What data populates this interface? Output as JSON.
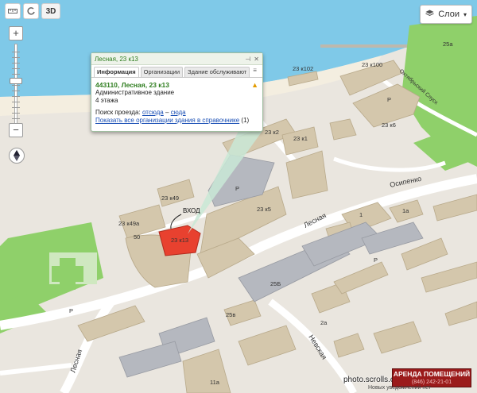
{
  "toolbar": {
    "ruler_icon": "ruler-icon",
    "rotate_icon": "rotate-icon",
    "mode_3d": "3D"
  },
  "layers": {
    "label": "Слои",
    "icon": "layers-icon"
  },
  "zoom": {
    "plus": "+",
    "minus": "−",
    "level_fraction": 0.55
  },
  "balloon": {
    "header": "Лесная, 23 к13",
    "tabs": [
      "Информация",
      "Организации",
      "Здание обслуживают"
    ],
    "active_tab": 0,
    "address": "443110, Лесная, 23 к13",
    "type": "Административное здание",
    "floors": "4 этажа",
    "route_label": "Поиск проезда:",
    "route_from": "отсюда",
    "route_dash": "–",
    "route_to": "сюда",
    "orgs_link": "Показать все организации здания в справочнике",
    "orgs_count": "(1)"
  },
  "map_labels": {
    "b_23x100": "23 к100",
    "b_23x102": "23 к102",
    "b_23x2": "23 к2",
    "b_23x1": "23 к1",
    "b_23x6": "23 к6",
    "b_23x49": "23 к49",
    "b_23x49a": "23 к49а",
    "b_50": "50",
    "b_23x13": "23 к13",
    "b_23x5": "23 к5",
    "b_1": "1",
    "b_1a": "1а",
    "b_25b": "25Б",
    "b_25v": "25в",
    "b_2a": "2а",
    "b_25a": "25а",
    "b_11a": "11а",
    "entrance": "ВХОД",
    "street_lesnaya_1": "Лесная",
    "street_lesnaya_2": "Лесная",
    "street_osipenko": "Осипенко",
    "street_nevskaya": "Невская",
    "street_spusk": "Октябрьский Спуск",
    "parking": "P"
  },
  "ad": {
    "title": "АРЕНДА ПОМЕЩЕНИЙ",
    "phone": "(846) 242-21-01"
  },
  "credit": "photo.scrolls.com/bats.com",
  "notice": "Новых уведомлений нет",
  "colors": {
    "water": "#7fc9e8",
    "beach": "#f0eadb",
    "park": "#8fd06a",
    "building": "#d4c7ac",
    "building_grey": "#b5b8bf",
    "road": "#ffffff",
    "selected": "#e8412f"
  }
}
